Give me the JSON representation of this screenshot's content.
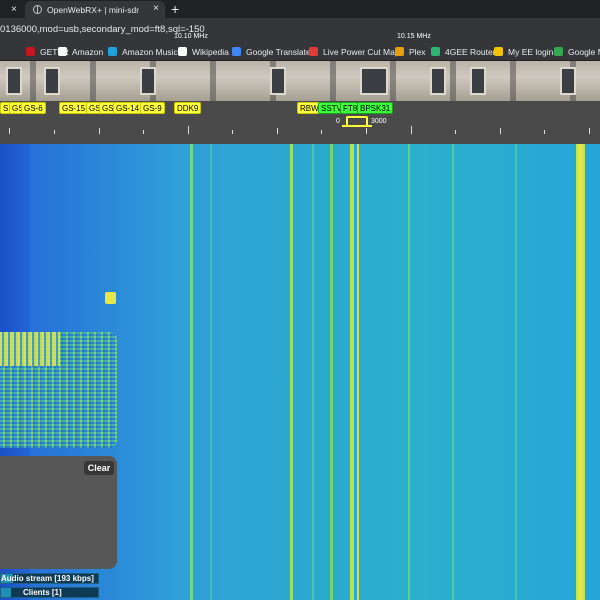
{
  "browser": {
    "active_tab_close": "×",
    "tab2_title": "OpenWebRX+ | mini-sdr",
    "tab2_close": "×",
    "new_tab": "+",
    "url": "0136000,mod=usb,secondary_mod=ft8,sql=-150"
  },
  "bookmarks": [
    {
      "label": "GETTR",
      "icon": "gettr-icon",
      "color": "#c4171f"
    },
    {
      "label": "Amazon",
      "icon": "amazon-icon",
      "color": "#ffffff"
    },
    {
      "label": "Amazon Music",
      "icon": "amazon-music-icon",
      "color": "#1fa2d9"
    },
    {
      "label": "Wikipedia",
      "icon": "wikipedia-icon",
      "color": "#ffffff"
    },
    {
      "label": "Google Translate",
      "icon": "google-translate-icon",
      "color": "#4285f4"
    },
    {
      "label": "Live Power Cut Map",
      "icon": "power-cut-icon",
      "color": "#e53935"
    },
    {
      "label": "Plex",
      "icon": "plex-icon",
      "color": "#e5a00d"
    },
    {
      "label": "4GEE Router",
      "icon": "ee-router-icon",
      "color": "#2bb673"
    },
    {
      "label": "My EE login",
      "icon": "ee-login-icon",
      "color": "#f5c400"
    },
    {
      "label": "Google Ma",
      "icon": "google-maps-icon",
      "color": "#34a853"
    }
  ],
  "sdr_bookmarks": [
    {
      "label": "S",
      "color": "yellow"
    },
    {
      "label": "GS",
      "color": "yellow"
    },
    {
      "label": "GS-6",
      "color": "yellow"
    },
    {
      "label": "GS-15",
      "color": "yellow"
    },
    {
      "label": "GS",
      "color": "yellow"
    },
    {
      "label": "GS",
      "color": "yellow"
    },
    {
      "label": "GS-14",
      "color": "yellow"
    },
    {
      "label": "GS-9",
      "color": "yellow"
    },
    {
      "label": "DDK9",
      "color": "yellow"
    },
    {
      "label": "RBW",
      "color": "yellow"
    },
    {
      "label": "SSTV",
      "color": "green"
    },
    {
      "label": "FT8",
      "color": "green"
    },
    {
      "label": "BPSK31",
      "color": "green"
    }
  ],
  "scale": {
    "label_1": "10.10 MHz",
    "label_2": "10.15 MHz",
    "passband_low": "0",
    "passband_high": "3000"
  },
  "messages_panel": {
    "clear_label": "Clear"
  },
  "status": {
    "audio_label": "Audio stream [193 kbps]",
    "audio_fill": 0.12,
    "clients_label": "Clients [1]",
    "clients_fill": 0.1
  },
  "colors": {
    "bookmark_yellow": "#ffff3a",
    "bookmark_green": "#3dff3d",
    "waterfall_base": "#2ba8cf"
  }
}
